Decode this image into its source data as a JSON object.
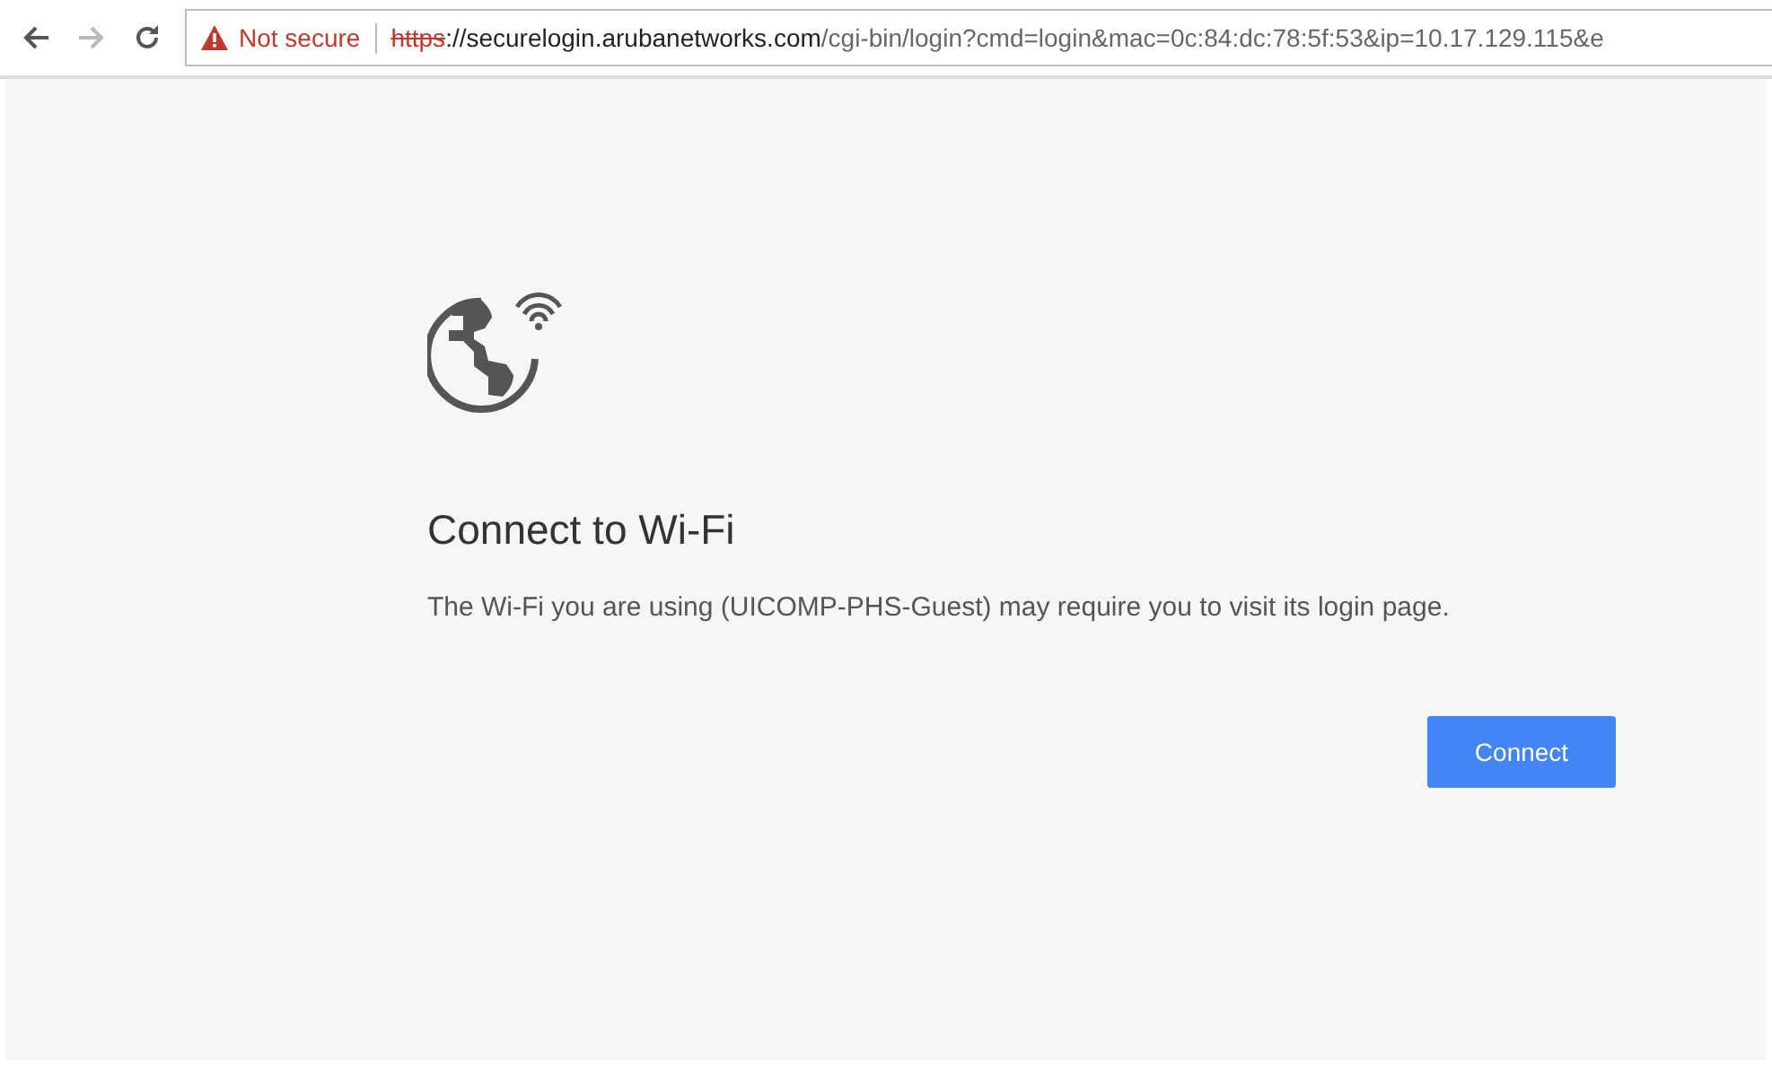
{
  "toolbar": {
    "nav_buttons": [
      {
        "kind": "back",
        "disabled": false
      },
      {
        "kind": "forward",
        "disabled": true
      },
      {
        "kind": "reload",
        "disabled": false
      }
    ],
    "address_bar": {
      "security_label": "Not secure",
      "scheme": "https",
      "scheme_struck": true,
      "host": "://securelogin.arubanetworks.com",
      "path": "/cgi-bin/login?cmd=login&mac=0c:84:dc:78:5f:53&ip=10.17.129.115&e"
    }
  },
  "page": {
    "title": "Connect to Wi-Fi",
    "message": "The Wi-Fi you are using (UICOMP-PHS-Guest) may require you to visit its login page.",
    "button": "Connect"
  }
}
